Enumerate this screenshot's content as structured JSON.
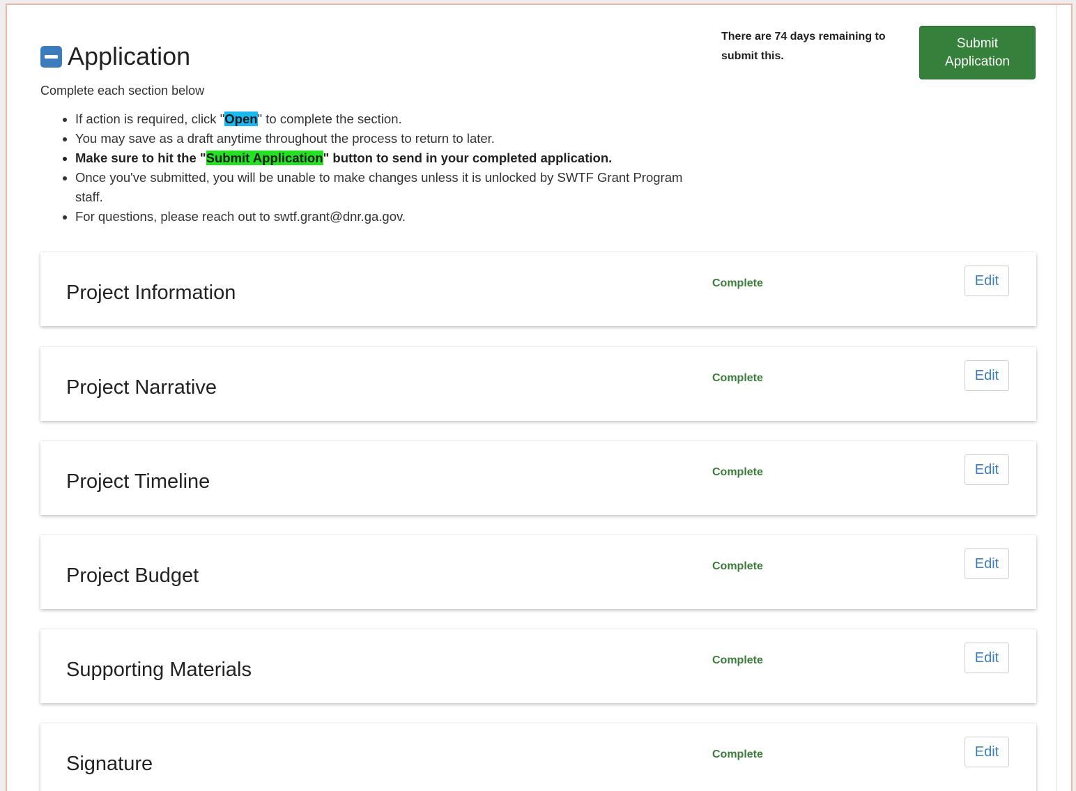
{
  "header": {
    "title": "Application",
    "subtitle": "Complete each section below"
  },
  "instructions": {
    "item1_pre": "If action is required, click \"",
    "item1_highlight": "Open",
    "item1_post": "\" to complete the section.",
    "item2": "You may save as a draft anytime throughout the process to return to later.",
    "item3_pre": "Make sure to hit the \"",
    "item3_highlight": "Submit Application",
    "item3_post": "\" button to send in your completed application.",
    "item4": "Once you've submitted, you will be unable to make changes unless it is unlocked by SWTF Grant Program staff.",
    "item5": "For questions, please reach out to swtf.grant@dnr.ga.gov."
  },
  "deadline": {
    "text": "There are 74 days remaining to submit this."
  },
  "submit_button": {
    "label": "Submit Application",
    "color": "#35803a"
  },
  "sections": [
    {
      "name": "Project Information",
      "status": "Complete",
      "action": "Edit"
    },
    {
      "name": "Project Narrative",
      "status": "Complete",
      "action": "Edit"
    },
    {
      "name": "Project Timeline",
      "status": "Complete",
      "action": "Edit"
    },
    {
      "name": "Project Budget",
      "status": "Complete",
      "action": "Edit"
    },
    {
      "name": "Supporting Materials",
      "status": "Complete",
      "action": "Edit"
    },
    {
      "name": "Signature",
      "status": "Complete",
      "action": "Edit"
    }
  ],
  "colors": {
    "accent_blue": "#3b7cbf",
    "status_green": "#3a7d3a",
    "highlight_open": "#19b9f0",
    "highlight_submit": "#22e222"
  },
  "icons": {
    "collapse": "minus-square-icon"
  }
}
